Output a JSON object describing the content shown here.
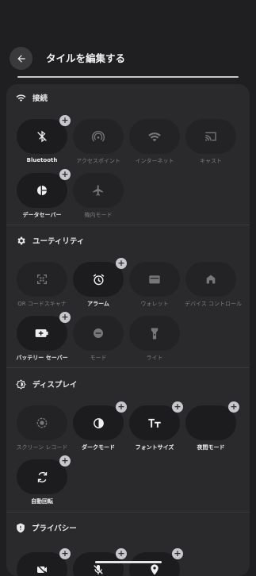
{
  "header": {
    "title": "タイルを編集する"
  },
  "sections": {
    "connection": {
      "label": "接続"
    },
    "utility": {
      "label": "ユーティリティ"
    },
    "display": {
      "label": "ディスプレイ"
    },
    "privacy": {
      "label": "プライバシー"
    }
  },
  "tiles": {
    "bluetooth": {
      "label": "Bluetooth"
    },
    "hotspot": {
      "label": "アクセスポイント"
    },
    "internet": {
      "label": "インターネット"
    },
    "cast": {
      "label": "キャスト"
    },
    "datasaver": {
      "label": "データセーバー"
    },
    "airplane": {
      "label": "機内モード"
    },
    "qr": {
      "label": "QR コードスキャナ"
    },
    "alarm": {
      "label": "アラーム"
    },
    "wallet": {
      "label": "ウォレット"
    },
    "device_control": {
      "label": "デバイス コントロール"
    },
    "battery_saver": {
      "label": "バッテリー セーバー"
    },
    "mode": {
      "label": "モード"
    },
    "flashlight": {
      "label": "ライト"
    },
    "screen_record": {
      "label": "スクリーン レコード"
    },
    "dark_mode": {
      "label": "ダークモード"
    },
    "font_size": {
      "label": "フォントサイズ"
    },
    "night_mode": {
      "label": "夜間モード"
    },
    "auto_rotate": {
      "label": "自動回転"
    }
  },
  "plus_symbol": "+"
}
